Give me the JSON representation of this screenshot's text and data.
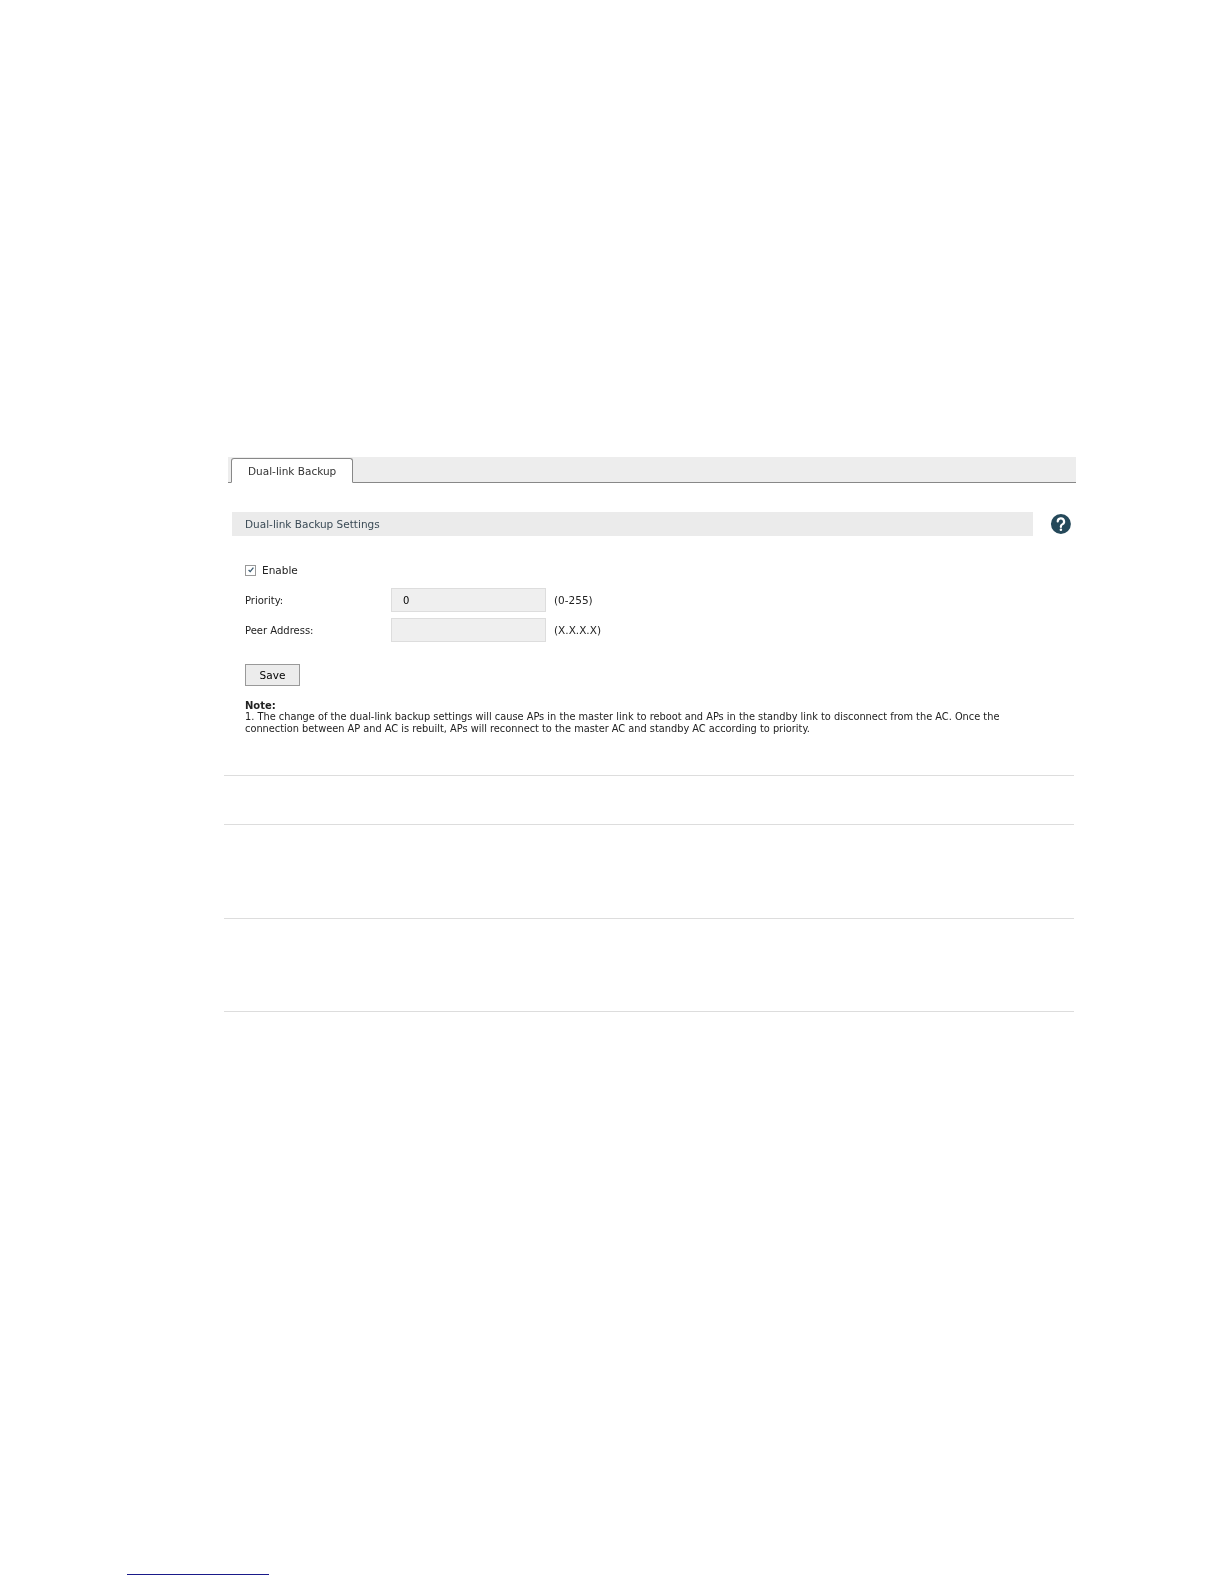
{
  "tabs": [
    {
      "label": "Dual-link Backup",
      "selected": true
    }
  ],
  "section": {
    "title": "Dual-link Backup Settings"
  },
  "enable": {
    "label": "Enable",
    "checked": true
  },
  "fields": [
    {
      "label": "Priority:",
      "value": "0",
      "hint": "(0-255)"
    },
    {
      "label": "Peer Address:",
      "hint": "(X.X.X.X)"
    }
  ],
  "save_button": "Save",
  "note": {
    "title": "Note:",
    "text": "1. The change of the dual-link backup settings will cause APs in the master link to reboot and APs in the standby link to disconnect from the AC. Once the connection between AP and AC is rebuilt, APs will reconnect to the master AC and standby AC according to priority."
  }
}
